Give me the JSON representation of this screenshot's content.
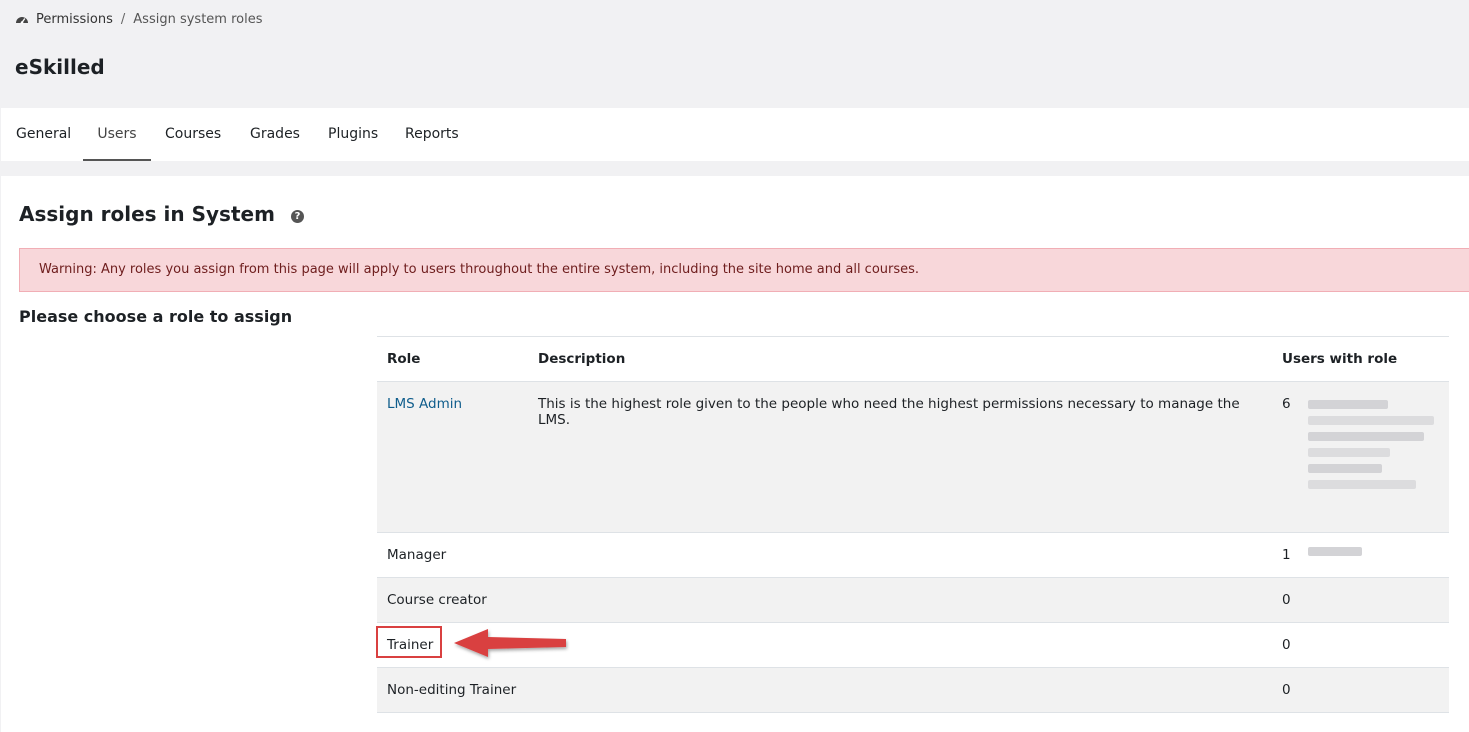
{
  "breadcrumb": {
    "items": [
      "Permissions",
      "Assign system roles"
    ],
    "separator": "/"
  },
  "site": {
    "title": "eSkilled"
  },
  "nav": {
    "tabs": [
      "General",
      "Users",
      "Courses",
      "Grades",
      "Plugins",
      "Reports"
    ],
    "active": "Users"
  },
  "page": {
    "heading": "Assign roles in System",
    "help_icon": "question-circle-icon",
    "warning": "Warning: Any roles you assign from this page will apply to users throughout the entire system, including the site home and all courses.",
    "subheading": "Please choose a role to assign"
  },
  "table": {
    "headers": [
      "Role",
      "Description",
      "Users with role"
    ],
    "rows": [
      {
        "role": "LMS Admin",
        "link": true,
        "description": "This is the highest role given to the people who need the highest permissions necessary to manage the LMS.",
        "count": "6"
      },
      {
        "role": "Manager",
        "link": false,
        "description": "",
        "count": "1"
      },
      {
        "role": "Course creator",
        "link": false,
        "description": "",
        "count": "0"
      },
      {
        "role": "Trainer",
        "link": false,
        "description": "",
        "count": "0",
        "highlighted": true
      },
      {
        "role": "Non-editing Trainer",
        "link": false,
        "description": "",
        "count": "0"
      }
    ]
  },
  "colors": {
    "link": "#0f5d8c",
    "warning_bg": "#f8d7da",
    "annotation": "#d94040"
  }
}
